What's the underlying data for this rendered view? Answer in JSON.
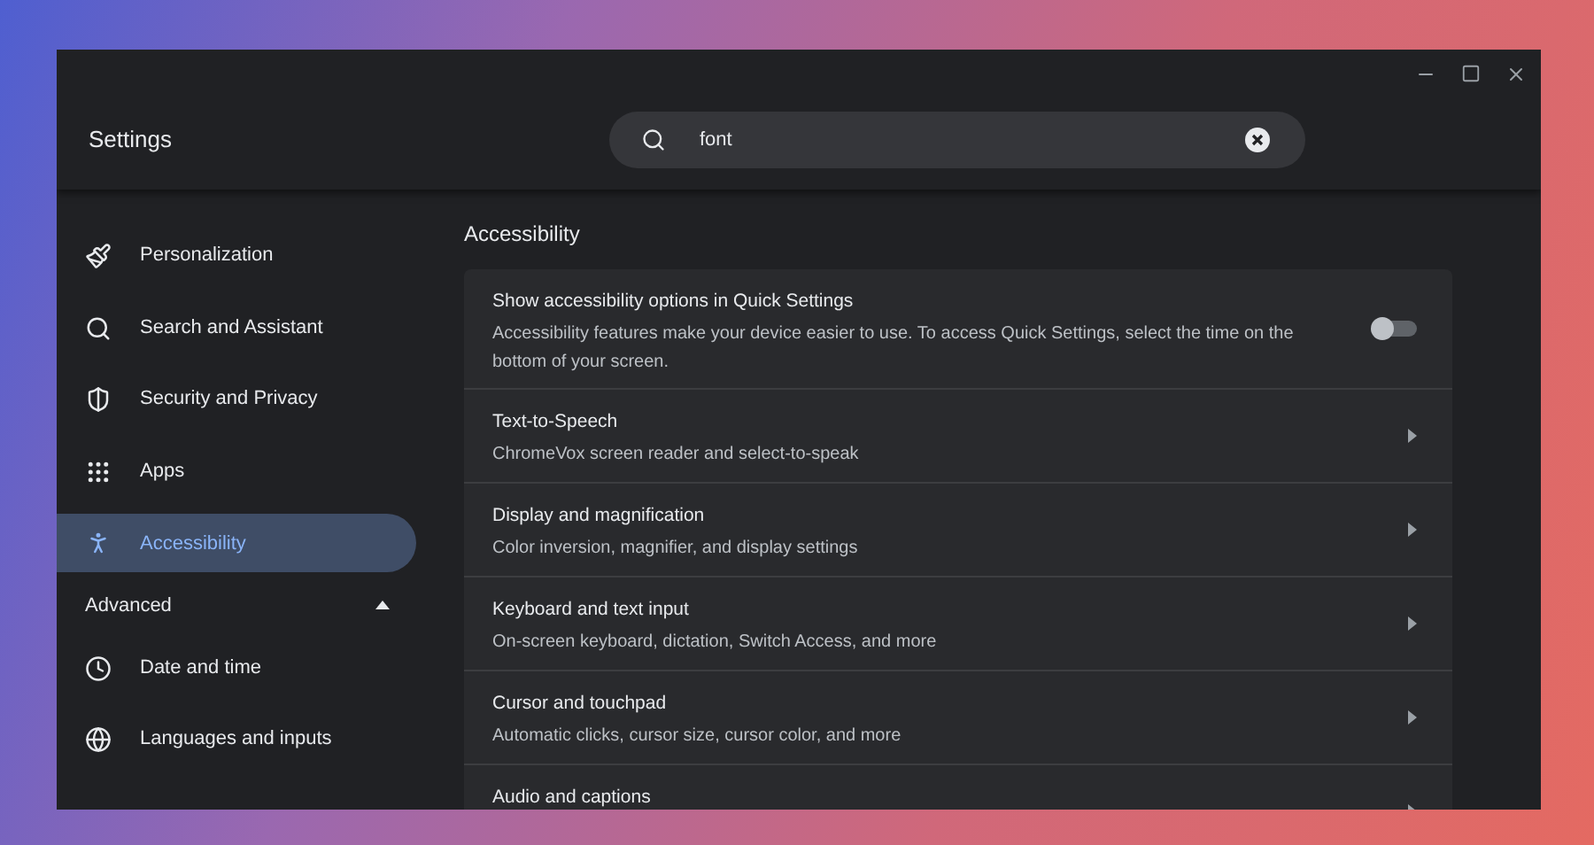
{
  "window": {
    "title": "Settings"
  },
  "search": {
    "value": "font"
  },
  "sidebar": {
    "items": [
      {
        "label": "Personalization",
        "selected": false
      },
      {
        "label": "Search and Assistant",
        "selected": false
      },
      {
        "label": "Security and Privacy",
        "selected": false
      },
      {
        "label": "Apps",
        "selected": false
      },
      {
        "label": "Accessibility",
        "selected": true
      }
    ],
    "advanced": {
      "label": "Advanced",
      "expanded": true,
      "items": [
        {
          "label": "Date and time",
          "selected": false
        },
        {
          "label": "Languages and inputs",
          "selected": false
        }
      ]
    }
  },
  "content": {
    "section_title": "Accessibility",
    "rows": [
      {
        "kind": "toggle",
        "title": "Show accessibility options in Quick Settings",
        "description": "Accessibility features make your device easier to use. To access Quick Settings, select the time on the bottom of your screen.",
        "on": false
      },
      {
        "kind": "link",
        "title": "Text-to-Speech",
        "description": "ChromeVox screen reader and select-to-speak"
      },
      {
        "kind": "link",
        "title": "Display and magnification",
        "description": "Color inversion, magnifier, and display settings"
      },
      {
        "kind": "link",
        "title": "Keyboard and text input",
        "description": "On-screen keyboard, dictation, Switch Access, and more"
      },
      {
        "kind": "link",
        "title": "Cursor and touchpad",
        "description": "Automatic clicks, cursor size, cursor color, and more"
      },
      {
        "kind": "link",
        "title": "Audio and captions"
      }
    ]
  }
}
